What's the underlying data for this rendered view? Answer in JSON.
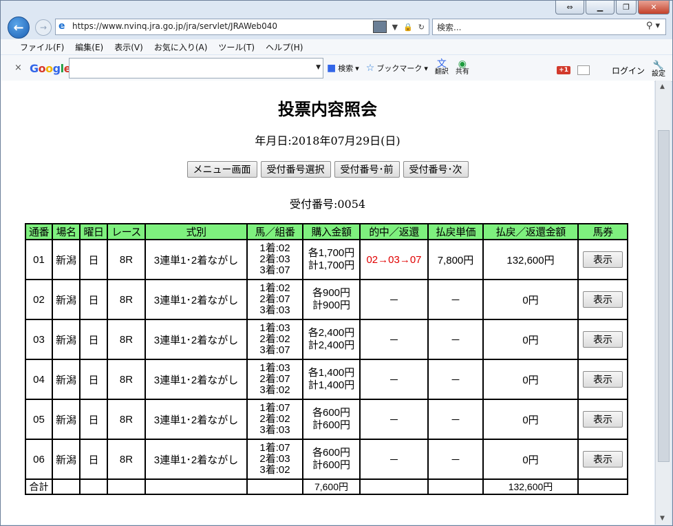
{
  "browser": {
    "url": "https://www.nvinq.jra.go.jp/jra/servlet/JRAWeb040",
    "search_placeholder": "検索...",
    "menu": [
      "ファイル(F)",
      "編集(E)",
      "表示(V)",
      "お気に入り(A)",
      "ツール(T)",
      "ヘルプ(H)"
    ],
    "google": {
      "logo": "Google",
      "search": "検索",
      "bookmark": "ブックマーク",
      "translate": "翻訳",
      "share": "共有",
      "gplus": "+1",
      "login": "ログイン",
      "settings": "設定"
    }
  },
  "page": {
    "title": "投票内容照会",
    "date": "年月日:2018年07月29日(日)",
    "buttons": {
      "menu": "メニュー画面",
      "select": "受付番号選択",
      "prev": "受付番号･前",
      "next": "受付番号･次"
    },
    "receipt": "受付番号:0054"
  },
  "table": {
    "headers": [
      "通番",
      "場名",
      "曜日",
      "レース",
      "式別",
      "馬／組番",
      "購入金額",
      "的中／返還",
      "払戻単価",
      "払戻／返還金額",
      "馬券"
    ],
    "show_label": "表示",
    "rows": [
      {
        "no": "01",
        "venue": "新潟",
        "day": "日",
        "race": "8R",
        "type": "3連単1･2着ながし",
        "h1": "1着:02",
        "h2": "2着:03",
        "h3": "3着:07",
        "each": "各1,700円",
        "total": "計1,700円",
        "hit": "02→03→07",
        "unit": "7,800円",
        "payout": "132,600円"
      },
      {
        "no": "02",
        "venue": "新潟",
        "day": "日",
        "race": "8R",
        "type": "3連単1･2着ながし",
        "h1": "1着:02",
        "h2": "2着:07",
        "h3": "3着:03",
        "each": "各900円",
        "total": "計900円",
        "hit": "－",
        "unit": "－",
        "payout": "0円"
      },
      {
        "no": "03",
        "venue": "新潟",
        "day": "日",
        "race": "8R",
        "type": "3連単1･2着ながし",
        "h1": "1着:03",
        "h2": "2着:02",
        "h3": "3着:07",
        "each": "各2,400円",
        "total": "計2,400円",
        "hit": "－",
        "unit": "－",
        "payout": "0円"
      },
      {
        "no": "04",
        "venue": "新潟",
        "day": "日",
        "race": "8R",
        "type": "3連単1･2着ながし",
        "h1": "1着:03",
        "h2": "2着:07",
        "h3": "3着:02",
        "each": "各1,400円",
        "total": "計1,400円",
        "hit": "－",
        "unit": "－",
        "payout": "0円"
      },
      {
        "no": "05",
        "venue": "新潟",
        "day": "日",
        "race": "8R",
        "type": "3連単1･2着ながし",
        "h1": "1着:07",
        "h2": "2着:02",
        "h3": "3着:03",
        "each": "各600円",
        "total": "計600円",
        "hit": "－",
        "unit": "－",
        "payout": "0円"
      },
      {
        "no": "06",
        "venue": "新潟",
        "day": "日",
        "race": "8R",
        "type": "3連単1･2着ながし",
        "h1": "1着:07",
        "h2": "2着:03",
        "h3": "3着:02",
        "each": "各600円",
        "total": "計600円",
        "hit": "－",
        "unit": "－",
        "payout": "0円"
      }
    ],
    "totals": {
      "label": "合計",
      "purchase": "7,600円",
      "payout": "132,600円"
    }
  }
}
